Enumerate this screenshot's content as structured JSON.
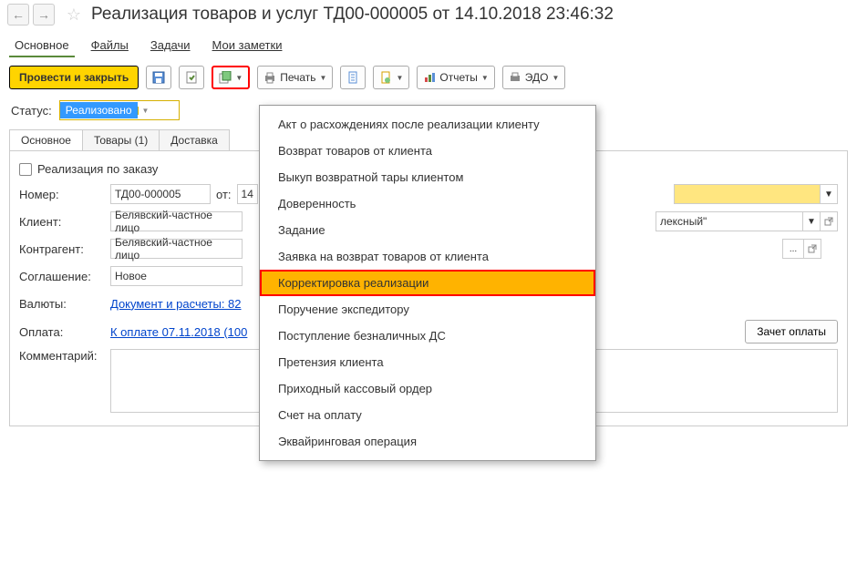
{
  "header": {
    "title": "Реализация товаров и услуг ТД00-000005 от 14.10.2018 23:46:32"
  },
  "nav_tabs": {
    "main": "Основное",
    "files": "Файлы",
    "tasks": "Задачи",
    "notes": "Мои заметки"
  },
  "toolbar": {
    "post_close": "Провести и закрыть",
    "print": "Печать",
    "reports": "Отчеты",
    "edo": "ЭДО"
  },
  "status": {
    "label": "Статус:",
    "value": "Реализовано"
  },
  "inner_tabs": {
    "main": "Основное",
    "goods": "Товары (1)",
    "delivery": "Доставка"
  },
  "form": {
    "by_order": "Реализация по заказу",
    "number_label": "Номер:",
    "number": "ТД00-000005",
    "from": "от:",
    "date_prefix": "14",
    "client_label": "Клиент:",
    "client": "Белявский-частное лицо",
    "warehouse_suffix": "лексный\"",
    "counterparty_label": "Контрагент:",
    "counterparty": "Белявский-частное лицо",
    "agreement_label": "Соглашение:",
    "agreement": "Новое",
    "currency_label": "Валюты:",
    "currency_link": "Документ и расчеты: 82",
    "payment_label": "Оплата:",
    "payment_link": "К оплате 07.11.2018 (100",
    "payment_offset": "Зачет оплаты",
    "comment_label": "Комментарий:"
  },
  "menu": {
    "items": [
      "Акт о расхождениях после реализации клиенту",
      "Возврат товаров от клиента",
      "Выкуп возвратной тары клиентом",
      "Доверенность",
      "Задание",
      "Заявка на возврат товаров от клиента",
      "Корректировка реализации",
      "Поручение экспедитору",
      "Поступление безналичных ДС",
      "Претензия клиента",
      "Приходный кассовый ордер",
      "Счет на оплату",
      "Эквайринговая операция"
    ],
    "selected_index": 6
  }
}
